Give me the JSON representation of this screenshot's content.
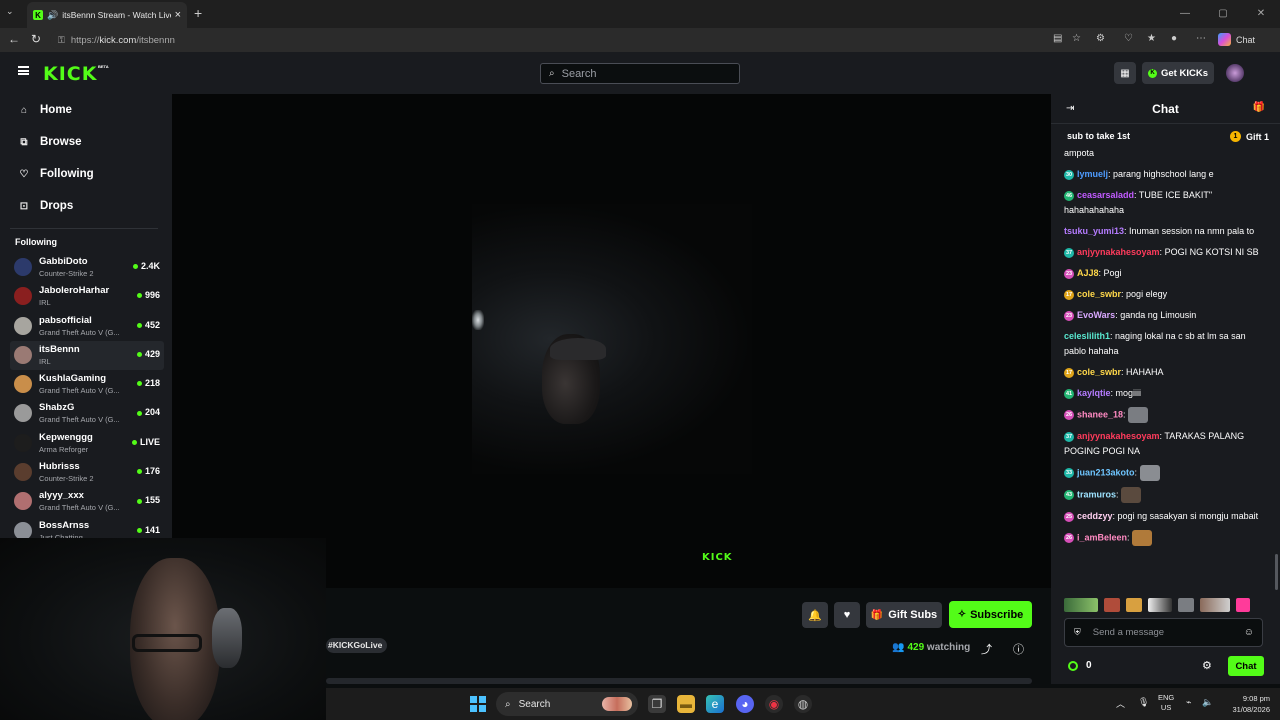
{
  "browser": {
    "tab_title": "itsBennn Stream - Watch Live",
    "url_scheme": "https://",
    "url_host": "kick.com",
    "url_path": "/itsbennn",
    "copilot_label": "Chat"
  },
  "header": {
    "logo": "KICK",
    "beta": "BETA",
    "search_placeholder": "Search",
    "get_kicks_label": "Get KICKs"
  },
  "sidebar": {
    "nav": [
      {
        "label": "Home",
        "icon": "home-icon"
      },
      {
        "label": "Browse",
        "icon": "browse-icon"
      },
      {
        "label": "Following",
        "icon": "heart-icon"
      },
      {
        "label": "Drops",
        "icon": "gift-icon"
      }
    ],
    "following_title": "Following",
    "following": [
      {
        "name": "GabbiDoto",
        "category": "Counter-Strike 2",
        "viewers": "2.4K",
        "color": "#2c3a6b"
      },
      {
        "name": "JaboleroHarhar",
        "category": "IRL",
        "viewers": "996",
        "color": "#8a1f1f"
      },
      {
        "name": "pabsofficial",
        "category": "Grand Theft Auto V (G...",
        "viewers": "452",
        "color": "#a7a59f"
      },
      {
        "name": "itsBennn",
        "category": "IRL",
        "viewers": "429",
        "color": "#9a7a74"
      },
      {
        "name": "KushlaGaming",
        "category": "Grand Theft Auto V (G...",
        "viewers": "218",
        "color": "#c98e4a"
      },
      {
        "name": "ShabzG",
        "category": "Grand Theft Auto V (G...",
        "viewers": "204",
        "color": "#9a9a9a"
      },
      {
        "name": "Kepwenggg",
        "category": "Arma Reforger",
        "viewers": "LIVE",
        "color": "#1d1d1d"
      },
      {
        "name": "Hubrisss",
        "category": "Counter-Strike 2",
        "viewers": "176",
        "color": "#5a3d2e"
      },
      {
        "name": "alyyy_xxx",
        "category": "Grand Theft Auto V (G...",
        "viewers": "155",
        "color": "#b06f70"
      },
      {
        "name": "BossArnss",
        "category": "Just Chatting",
        "viewers": "141",
        "color": "#8b8f96"
      }
    ]
  },
  "stream": {
    "watermark": "KICK",
    "tag": "#KICKGoLive",
    "gift_subs_label": "Gift Subs",
    "subscribe_label": "Subscribe",
    "watching_count": "429",
    "watching_label": "watching"
  },
  "chat": {
    "title": "Chat",
    "pinned_text": "sub to take 1st",
    "pinned_gift": "Gift 1",
    "messages": [
      {
        "user": "",
        "text": "ampota",
        "color": "#ffffff",
        "badge": "",
        "badge_color": ""
      },
      {
        "user": "lymuelj",
        "text": "parang highschool lang e",
        "color": "#4e9cff",
        "badge": "30",
        "badge_color": "#1fb8a8"
      },
      {
        "user": "ceasarsaladd",
        "text": "TUBE ICE BAKIT\" hahahahahaha",
        "color": "#c15bff",
        "badge": "46",
        "badge_color": "#22b573"
      },
      {
        "user": "tsuku_yumi13",
        "text": "Inuman session na nmn pala to",
        "color": "#b57cff",
        "badge": "",
        "badge_color": ""
      },
      {
        "user": "anjyynakahesoyam",
        "text": "POGI NG KOTSI NI SB",
        "color": "#ff3b5c",
        "badge": "37",
        "badge_color": "#1fb8a8"
      },
      {
        "user": "AJJ8",
        "text": "Pogi",
        "color": "#ffd84a",
        "badge": "23",
        "badge_color": "#d64fb8"
      },
      {
        "user": "cole_swbr",
        "text": "pogi elegy",
        "color": "#ffd84a",
        "badge": "17",
        "badge_color": "#e0a51a"
      },
      {
        "user": "EvoWars",
        "text": "ganda ng Limousin",
        "color": "#d9a8ff",
        "badge": "23",
        "badge_color": "#d64fb8"
      },
      {
        "user": "celeslilith1",
        "text": "naging lokal na c sb at lm sa san pablo hahaha",
        "color": "#59e8d0",
        "badge": "",
        "badge_color": ""
      },
      {
        "user": "cole_swbr",
        "text": "HAHAHA",
        "color": "#ffd84a",
        "badge": "17",
        "badge_color": "#e0a51a"
      },
      {
        "user": "kaylqtie",
        "text": "mogiiii",
        "color": "#b57cff",
        "badge": "41",
        "badge_color": "#22b573"
      },
      {
        "user": "shanee_18",
        "text": "",
        "color": "#ff8ac2",
        "badge": "26",
        "badge_color": "#d64fb8",
        "emote": "#7a7d82"
      },
      {
        "user": "anjyynakahesoyam",
        "text": "TARAKAS PALANG POGING POGI NA",
        "color": "#ff3b5c",
        "badge": "37",
        "badge_color": "#1fb8a8"
      },
      {
        "user": "juan213akoto",
        "text": "",
        "color": "#6fc6ff",
        "badge": "33",
        "badge_color": "#1fb8a8",
        "emote": "#8a8d92"
      },
      {
        "user": "tramuros",
        "text": "",
        "color": "#9ee3ff",
        "badge": "43",
        "badge_color": "#22b573",
        "emote": "#5a4a3e"
      },
      {
        "user": "ceddzyy",
        "text": "pogi ng sasakyan si mongju mabait",
        "color": "#ffd0f0",
        "badge": "25",
        "badge_color": "#d64fb8"
      },
      {
        "user": "i_amBeleen",
        "text": "",
        "color": "#ff8ac2",
        "badge": "26",
        "badge_color": "#d64fb8",
        "emote": "#b07a3a"
      }
    ],
    "input_placeholder": "Send a message",
    "points": "0",
    "chat_button": "Chat"
  },
  "taskbar": {
    "search_label": "Search",
    "lang_line1": "ENG",
    "lang_line2": "US",
    "time": "9:08 pm",
    "date": "31/08/2026"
  }
}
